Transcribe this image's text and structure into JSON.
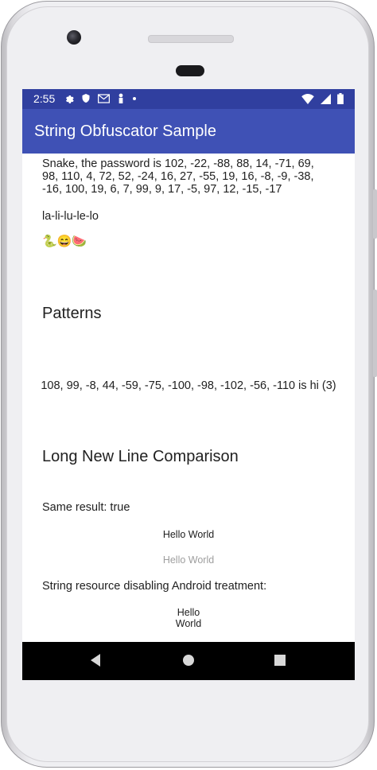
{
  "status_bar": {
    "time": "2:55",
    "left_icons": [
      "gear-icon",
      "shield-icon",
      "gmail-icon",
      "person-icon",
      "dot-icon"
    ],
    "right_icons": [
      "wifi-icon",
      "signal-icon",
      "battery-icon"
    ]
  },
  "app_bar": {
    "title": "String Obfuscator Sample"
  },
  "content": {
    "password_text": "Snake, the password is 102, -22, -88, 88, 14, -71, 69, 98, 110, 4, 72, 52, -24, 16, 27, -55, 19, 16, -8, -9, -38, -16, 100, 19, 6, 7, 99, 9, 17, -5, 97, 12, -15, -17",
    "lalilu_text": "la-li-lu-le-lo",
    "emoji_text": "🐍😄🍉",
    "patterns_heading": "Patterns",
    "patterns_text": "108, 99, -8, 44, -59, -75, -100, -98, -102, -56, -110 is hi (3)",
    "long_newline_heading": "Long New Line Comparison",
    "same_result_text": "Same result: true",
    "hello_world_1": "Hello World",
    "hello_world_2": "Hello World",
    "resource_text": "String resource disabling Android treatment:",
    "hello_line": "Hello",
    "world_line": "World"
  },
  "nav_bar": {
    "buttons": [
      "back-icon",
      "home-icon",
      "recents-icon"
    ]
  },
  "colors": {
    "status_bar": "#303f9f",
    "app_bar": "#3f51b5",
    "text": "#212121",
    "faded_text": "#9e9e9e"
  }
}
